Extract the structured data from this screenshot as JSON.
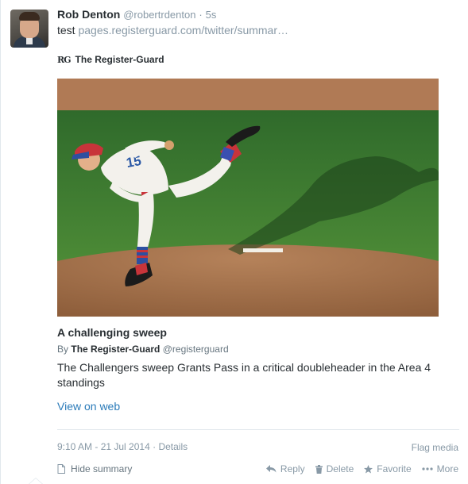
{
  "tweet": {
    "fullname": "Rob Denton",
    "username": "@robertrdenton",
    "dot": "·",
    "time_ago": "5s",
    "text": "test",
    "link": "pages.registerguard.com/twitter/summar…"
  },
  "card": {
    "publisher_logo": "RG",
    "publisher": "The Register-Guard",
    "title": "A challenging sweep",
    "by": "By",
    "by_name": "The Register-Guard",
    "by_handle": "@registerguard",
    "description": "The Challengers sweep Grants Pass in a critical doubleheader in the Area 4 standings",
    "view_web": "View on web",
    "jersey_number": "15"
  },
  "meta": {
    "timestamp": "9:10 AM - 21 Jul 2014",
    "dot": "·",
    "details": "Details",
    "flag_media": "Flag media"
  },
  "footer": {
    "hide_summary": "Hide summary",
    "reply": "Reply",
    "delete": "Delete",
    "favorite": "Favorite",
    "more": "More"
  },
  "colors": {
    "link_blue": "#2b7bb9",
    "muted": "#8899a6",
    "field_green": "#4c8a36",
    "dirt": "#a3714a"
  }
}
